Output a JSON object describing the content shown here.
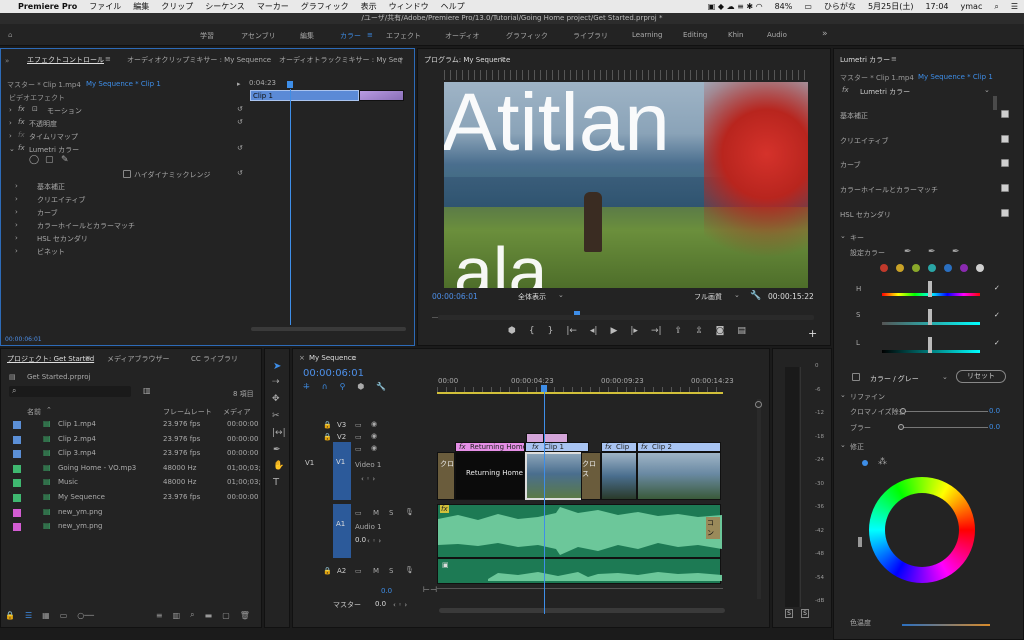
{
  "menubar": {
    "apple": "",
    "app": "Premiere Pro",
    "items": [
      "ファイル",
      "編集",
      "クリップ",
      "シーケンス",
      "マーカー",
      "グラフィック",
      "表示",
      "ウィンドウ",
      "ヘルプ"
    ],
    "battery": "84%",
    "ime": "ひらがな",
    "date": "5月25日(土)",
    "time": "17:04",
    "user": "ymac"
  },
  "title": "/ユーザ/共有/Adobe/Premiere Pro/13.0/Tutorial/Going Home project/Get Started.prproj *",
  "workspaces": [
    "学習",
    "アセンブリ",
    "編集",
    "カラー",
    "エフェクト",
    "オーディオ",
    "グラフィック",
    "ライブラリ",
    "Learning",
    "Editing",
    "Khin",
    "Audio"
  ],
  "effect_controls": {
    "tabs": [
      "エフェクトコントロール",
      "オーディオクリップミキサー : My Sequence",
      "オーディオトラックミキサー : My Seq"
    ],
    "source": "マスター * Clip 1.mp4",
    "seq": "My Sequence * Clip 1",
    "tc_head": "0:04:23",
    "clip_label": "Clip 1",
    "section": "ビデオエフェクト",
    "effects": [
      "モーション",
      "不透明度",
      "タイムリマップ",
      "Lumetri カラー"
    ],
    "hdr": "ハイダイナミックレンジ",
    "sub": [
      "基本補正",
      "クリエイティブ",
      "カーブ",
      "カラーホイールとカラーマッチ",
      "HSL セカンダリ",
      "ビネット"
    ],
    "timecode": "00:00:06:01"
  },
  "program": {
    "title": "プログラム: My Sequence",
    "overlay_text1": "Atitlan",
    "overlay_text2": "ala",
    "timecode": "00:00:06:01",
    "zoom": "全体表示",
    "quality": "フル画質",
    "duration": "00:00:15:22"
  },
  "lumetri": {
    "title": "Lumetri カラー",
    "source": "マスター * Clip 1.mp4",
    "seq": "My Sequence * Clip 1",
    "effect": "Lumetri カラー",
    "sections": [
      "基本補正",
      "クリエイティブ",
      "カーブ",
      "カラーホイールとカラーマッチ",
      "HSL セカンダリ"
    ],
    "key": "キー",
    "setcolor": "設定カラー",
    "hsl": [
      "H",
      "S",
      "L"
    ],
    "colorgray": "カラー / グレー",
    "reset": "リセット",
    "refine": "リファイン",
    "denoise": "クロマノイズ除去",
    "blur": "ブラー",
    "denoise_val": "0.0",
    "blur_val": "0.0",
    "correction": "修正",
    "temp": "色温度",
    "swatches": [
      "#c0392b",
      "#c9a227",
      "#8aa82a",
      "#2aa6a6",
      "#2a6fc0",
      "#8a2ab0",
      "#cfcfcf"
    ]
  },
  "project": {
    "tabs": [
      "プロジェクト: Get Started",
      "メディアブラウザー",
      "CC ライブラリ"
    ],
    "file": "Get Started.prproj",
    "count": "8 項目",
    "headers": [
      "名前",
      "フレームレート",
      "メディア"
    ],
    "items": [
      {
        "name": "Clip 1.mp4",
        "fps": "23.976 fps",
        "media": "00:00:00",
        "color": "#5b8fd6"
      },
      {
        "name": "Clip 2.mp4",
        "fps": "23.976 fps",
        "media": "00:00:00",
        "color": "#5b8fd6"
      },
      {
        "name": "Clip 3.mp4",
        "fps": "23.976 fps",
        "media": "00:00:00",
        "color": "#5b8fd6"
      },
      {
        "name": "Going Home - VO.mp3",
        "fps": "48000 Hz",
        "media": "01;00;03;",
        "color": "#3fb870"
      },
      {
        "name": "Music",
        "fps": "48000 Hz",
        "media": "01;00;03;",
        "color": "#3fb870"
      },
      {
        "name": "My Sequence",
        "fps": "23.976 fps",
        "media": "00:00:00",
        "color": "#3fb870"
      },
      {
        "name": "new_ym.png",
        "fps": "",
        "media": "",
        "color": "#d35dd3"
      },
      {
        "name": "new_ym.png",
        "fps": "",
        "media": "",
        "color": "#d35dd3"
      }
    ]
  },
  "timeline": {
    "tab": "My Sequence",
    "timecode": "00:00:06:01",
    "ruler": [
      "00:00",
      "00:00:04:23",
      "00:00:09:23",
      "00:00:14:23"
    ],
    "tracks_v": [
      "V3",
      "V2",
      "V1"
    ],
    "track_v1_name": "Video 1",
    "tracks_a": [
      "A1",
      "A2"
    ],
    "track_a1_name": "Audio 1",
    "master": "マスター",
    "master_val": "0.0",
    "a1_val": "0.0",
    "clips": {
      "returning_top": "Returning Home",
      "returning": "Returning Home",
      "clip1": "Clip 1",
      "clip2": "Clip 2",
      "clip": "Clip",
      "cross1": "クロ",
      "cross2": "クロス",
      "cross3": "コン"
    }
  },
  "meter": {
    "scale": [
      "0",
      "-6",
      "-12",
      "-18",
      "-24",
      "-30",
      "-36",
      "-42",
      "-48",
      "-54",
      "-dB"
    ],
    "solo": [
      "S",
      "S"
    ]
  }
}
